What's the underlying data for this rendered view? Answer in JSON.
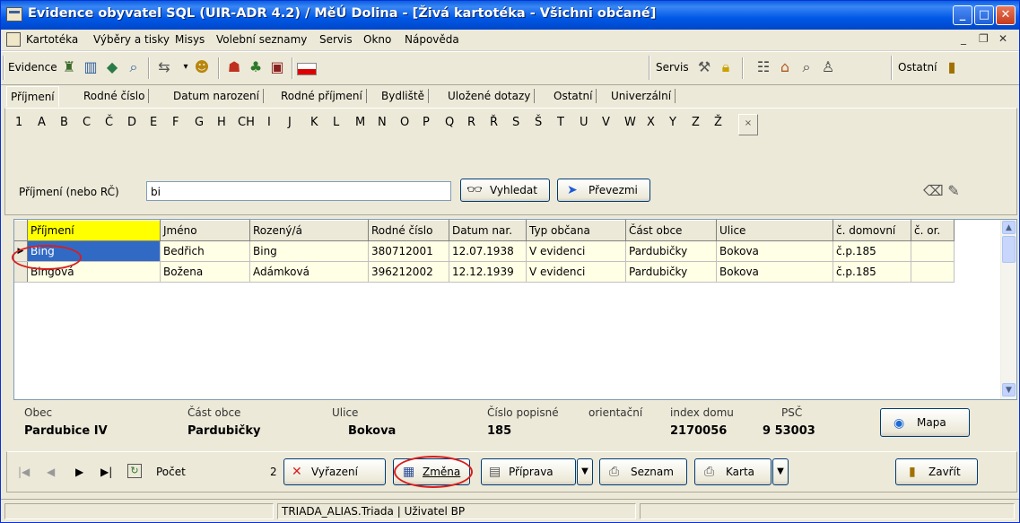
{
  "window": {
    "title": "Evidence obyvatel SQL  (UIR-ADR 4.2) / MěÚ Dolina - [Živá kartotéka - Všichni občané]"
  },
  "menu": [
    "Kartotéka",
    "Výběry a tisky",
    "Misys",
    "Volební seznamy",
    "Servis",
    "Okno",
    "Nápověda"
  ],
  "toolbar": {
    "evidence_label": "Evidence",
    "servis_label": "Servis",
    "ostatni_label": "Ostatní"
  },
  "tabs": [
    "Příjmení",
    "Rodné číslo",
    "Datum narození",
    "Rodné příjmení",
    "Bydliště",
    "Uložené dotazy",
    "Ostatní",
    "Univerzální"
  ],
  "active_tab": "Příjmení",
  "alphabet": [
    "1",
    "A",
    "B",
    "C",
    "Č",
    "D",
    "E",
    "F",
    "G",
    "H",
    "CH",
    "I",
    "J",
    "K",
    "L",
    "M",
    "N",
    "O",
    "P",
    "Q",
    "R",
    "Ř",
    "S",
    "Š",
    "T",
    "U",
    "V",
    "W",
    "X",
    "Y",
    "Z",
    "Ž"
  ],
  "alphabet_clear": "×",
  "search": {
    "label": "Příjmení (nebo RČ)",
    "value": "bi",
    "find_button": "Vyhledat",
    "take_button": "Převezmi"
  },
  "grid": {
    "columns": [
      "Příjmení",
      "Jméno",
      "Rozený/á",
      "Rodné číslo",
      "Datum nar.",
      "Typ občana",
      "Část obce",
      "Ulice",
      "č. domovní",
      "č. or."
    ],
    "rows": [
      [
        "Bing",
        "Bedřich",
        "Bing",
        "380712001",
        "12.07.1938",
        "V evidenci",
        "Pardubičky",
        "Bokova",
        "č.p.185",
        ""
      ],
      [
        "Bingová",
        "Božena",
        "Adámková",
        "396212002",
        "12.12.1939",
        "V evidenci",
        "Pardubičky",
        "Bokova",
        "č.p.185",
        ""
      ]
    ],
    "selected_row": 0
  },
  "info": {
    "obec_h": "Obec",
    "obec_v": "Pardubice IV",
    "cast_h": "Část obce",
    "cast_v": "Pardubičky",
    "ulice_h": "Ulice",
    "ulice_v": "Bokova",
    "cislo_h": "Číslo popisné",
    "cislo_v": "185",
    "orient_h": "orientační",
    "index_h": "index domu",
    "index_v": "2170056",
    "psc_h": "PSČ",
    "psc_v": "9 53003",
    "mapa": "Mapa"
  },
  "nav": {
    "pocet_label": "Počet",
    "pocet_value": "2",
    "vyrazeni": "Vyřazení",
    "zmena": "Změna",
    "priprava": "Příprava",
    "seznam": "Seznam",
    "karta": "Karta",
    "zavrit": "Zavřít"
  },
  "status": {
    "db": "TRIADA_ALIAS.Triada",
    "user": "Uživatel BP"
  }
}
